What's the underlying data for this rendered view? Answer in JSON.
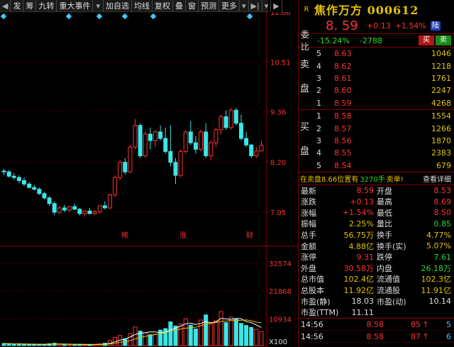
{
  "toolbar": {
    "items": [
      "发",
      "筹",
      "九转",
      "重大事件",
      "加自选",
      "均线",
      "复权",
      "叠",
      "窗",
      "预测",
      "更多"
    ]
  },
  "chart": {
    "price_axis": [
      "11.66",
      "10.51",
      "9.36",
      "8.20",
      "7.05"
    ],
    "volume_axis": [
      "32574",
      "21868",
      "10934",
      "X100"
    ],
    "event_markers": [
      "榜",
      "涨",
      "财"
    ],
    "up_color": "#ff3232",
    "down_color": "#3ce6e6",
    "ma_colors": [
      "#ffffff",
      "#e6c300"
    ],
    "candles": [
      [
        8.0,
        8.05,
        7.9,
        7.98
      ],
      [
        7.98,
        8.02,
        7.85,
        7.88
      ],
      [
        7.88,
        7.95,
        7.8,
        7.85
      ],
      [
        7.85,
        7.9,
        7.72,
        7.78
      ],
      [
        7.78,
        7.85,
        7.65,
        7.7
      ],
      [
        7.7,
        7.75,
        7.6,
        7.62
      ],
      [
        7.62,
        7.68,
        7.55,
        7.58
      ],
      [
        7.58,
        7.62,
        7.45,
        7.48
      ],
      [
        7.48,
        7.52,
        7.35,
        7.38
      ],
      [
        7.38,
        7.42,
        7.2,
        7.25
      ],
      [
        7.25,
        7.3,
        6.98,
        7.05
      ],
      [
        7.05,
        7.2,
        7.0,
        7.15
      ],
      [
        7.15,
        7.22,
        7.05,
        7.1
      ],
      [
        7.1,
        7.2,
        7.05,
        7.18
      ],
      [
        7.18,
        7.25,
        7.1,
        7.12
      ],
      [
        7.12,
        7.15,
        6.98,
        7.02
      ],
      [
        7.02,
        7.1,
        6.95,
        7.08
      ],
      [
        7.08,
        7.15,
        7.0,
        7.02
      ],
      [
        7.02,
        7.1,
        6.98,
        7.06
      ],
      [
        7.06,
        7.22,
        7.02,
        7.2
      ],
      [
        7.2,
        7.3,
        7.12,
        7.15
      ],
      [
        7.15,
        7.48,
        7.12,
        7.45
      ],
      [
        7.45,
        7.9,
        7.4,
        7.85
      ],
      [
        7.85,
        8.25,
        7.8,
        8.2
      ],
      [
        8.2,
        8.3,
        7.92,
        7.98
      ],
      [
        7.98,
        8.6,
        7.95,
        8.55
      ],
      [
        8.55,
        9.2,
        8.5,
        9.05
      ],
      [
        9.05,
        9.1,
        8.3,
        8.35
      ],
      [
        8.35,
        8.9,
        8.3,
        8.85
      ],
      [
        8.85,
        9.0,
        8.5,
        8.7
      ],
      [
        8.7,
        8.95,
        8.55,
        8.9
      ],
      [
        8.9,
        9.05,
        8.7,
        8.75
      ],
      [
        8.75,
        9.0,
        8.4,
        8.45
      ],
      [
        8.45,
        9.05,
        8.1,
        8.2
      ],
      [
        8.2,
        8.3,
        7.7,
        7.9
      ],
      [
        7.9,
        8.5,
        7.85,
        8.45
      ],
      [
        8.45,
        8.95,
        8.4,
        8.9
      ],
      [
        8.9,
        9.15,
        8.6,
        8.65
      ],
      [
        8.65,
        8.8,
        8.4,
        8.5
      ],
      [
        8.5,
        8.95,
        8.45,
        8.9
      ],
      [
        8.9,
        9.1,
        8.3,
        8.35
      ],
      [
        8.35,
        8.7,
        8.25,
        8.65
      ],
      [
        8.65,
        9.0,
        8.55,
        8.95
      ],
      [
        8.95,
        9.3,
        8.85,
        9.25
      ],
      [
        9.25,
        9.4,
        8.95,
        9.0
      ],
      [
        9.0,
        9.45,
        8.95,
        9.4
      ],
      [
        9.4,
        9.45,
        9.05,
        9.1
      ],
      [
        9.1,
        9.3,
        8.7,
        8.75
      ],
      [
        8.75,
        8.9,
        8.55,
        8.6
      ],
      [
        8.6,
        8.62,
        8.3,
        8.35
      ],
      [
        8.35,
        8.55,
        8.3,
        8.46
      ],
      [
        8.46,
        8.69,
        8.46,
        8.59
      ]
    ],
    "volumes": [
      1400,
      1200,
      1100,
      1300,
      1000,
      900,
      950,
      1100,
      1050,
      1300,
      1500,
      1000,
      900,
      850,
      950,
      1100,
      800,
      900,
      1000,
      1200,
      1500,
      2600,
      3800,
      4500,
      3200,
      5200,
      7800,
      6200,
      5500,
      4800,
      5000,
      6600,
      7200,
      9800,
      8200,
      9000,
      11000,
      8500,
      7000,
      10500,
      12500,
      8800,
      10200,
      13800,
      9500,
      11600,
      10800,
      9200,
      8400,
      7600,
      6900,
      6000
    ]
  },
  "panel": {
    "r_badge": "R",
    "title": "焦作万方 000612",
    "price": "8. 59",
    "change": "+0.13",
    "change_pct": "+1.54%",
    "tag": "陆",
    "weibi_label": "委比",
    "weibi": "-15.24%",
    "weicha": "-2788",
    "buy_btn": "买",
    "sell_btn": "卖",
    "sell_side_label": [
      "卖",
      "盘"
    ],
    "buy_side_label": [
      "买",
      "盘"
    ],
    "asks": [
      {
        "lv": "5",
        "price": "8.63",
        "vol": "1046"
      },
      {
        "lv": "4",
        "price": "8.62",
        "vol": "1218"
      },
      {
        "lv": "3",
        "price": "8.61",
        "vol": "1761"
      },
      {
        "lv": "2",
        "price": "8.60",
        "vol": "2247"
      },
      {
        "lv": "1",
        "price": "8.59",
        "vol": "4268"
      }
    ],
    "bids": [
      {
        "lv": "1",
        "price": "8.58",
        "vol": "1554"
      },
      {
        "lv": "2",
        "price": "8.57",
        "vol": "1266"
      },
      {
        "lv": "3",
        "price": "8.56",
        "vol": "1870"
      },
      {
        "lv": "4",
        "price": "8.55",
        "vol": "2383"
      },
      {
        "lv": "5",
        "price": "8.54",
        "vol": "679"
      }
    ],
    "trade_info": {
      "a": "在卖盘8.66位置有",
      "b": "3270手",
      "c": "卖单!",
      "d": "查看详细"
    },
    "stats": [
      {
        "k": "最新",
        "v": "8.59",
        "vc": "red",
        "k2": "开盘",
        "v2": "8.53",
        "v2c": "red"
      },
      {
        "k": "涨跌",
        "v": "+0.13",
        "vc": "red",
        "k2": "最高",
        "v2": "8.69",
        "v2c": "red"
      },
      {
        "k": "涨幅",
        "v": "+1.54%",
        "vc": "red",
        "k2": "最低",
        "v2": "8.50",
        "v2c": "red"
      },
      {
        "k": "振幅",
        "v": "2.25%",
        "vc": "yel",
        "k2": "量比",
        "v2": "0.85",
        "v2c": "grn"
      },
      {
        "k": "总手",
        "v": "56.75万",
        "vc": "yel",
        "k2": "换手",
        "v2": "4.77%",
        "v2c": "yel"
      },
      {
        "k": "金额",
        "v": "4.88亿",
        "vc": "yel",
        "k2": "换手(实)",
        "v2": "5.07%",
        "v2c": "yel"
      },
      {
        "k": "涨停",
        "v": "9.31",
        "vc": "red",
        "k2": "跌停",
        "v2": "7.61",
        "v2c": "grn"
      },
      {
        "k": "外盘",
        "v": "30.58万",
        "vc": "red",
        "k2": "内盘",
        "v2": "26.18万",
        "v2c": "grn"
      },
      {
        "k": "总市值",
        "v": "102.4亿",
        "vc": "yel",
        "k2": "流通值",
        "v2": "102.3亿",
        "v2c": "yel"
      },
      {
        "k": "总股本",
        "v": "11.92亿",
        "vc": "yel",
        "k2": "流通股",
        "v2": "11.91亿",
        "v2c": "yel"
      },
      {
        "k": "市盈(静)",
        "v": "18.03",
        "vc": "wht",
        "k2": "市盈(动)",
        "v2": "10.14",
        "v2c": "wht"
      },
      {
        "k": "市盈(TTM)",
        "v": "11.11",
        "vc": "wht",
        "k2": "",
        "v2": "",
        "v2c": "wht"
      }
    ],
    "ticks": [
      {
        "t": "14:56",
        "p": "8.58",
        "v": "85",
        "a": "↑",
        "n": "5"
      },
      {
        "t": "14:56",
        "p": "8.58",
        "v": "87",
        "a": "↑",
        "n": "6"
      }
    ]
  }
}
